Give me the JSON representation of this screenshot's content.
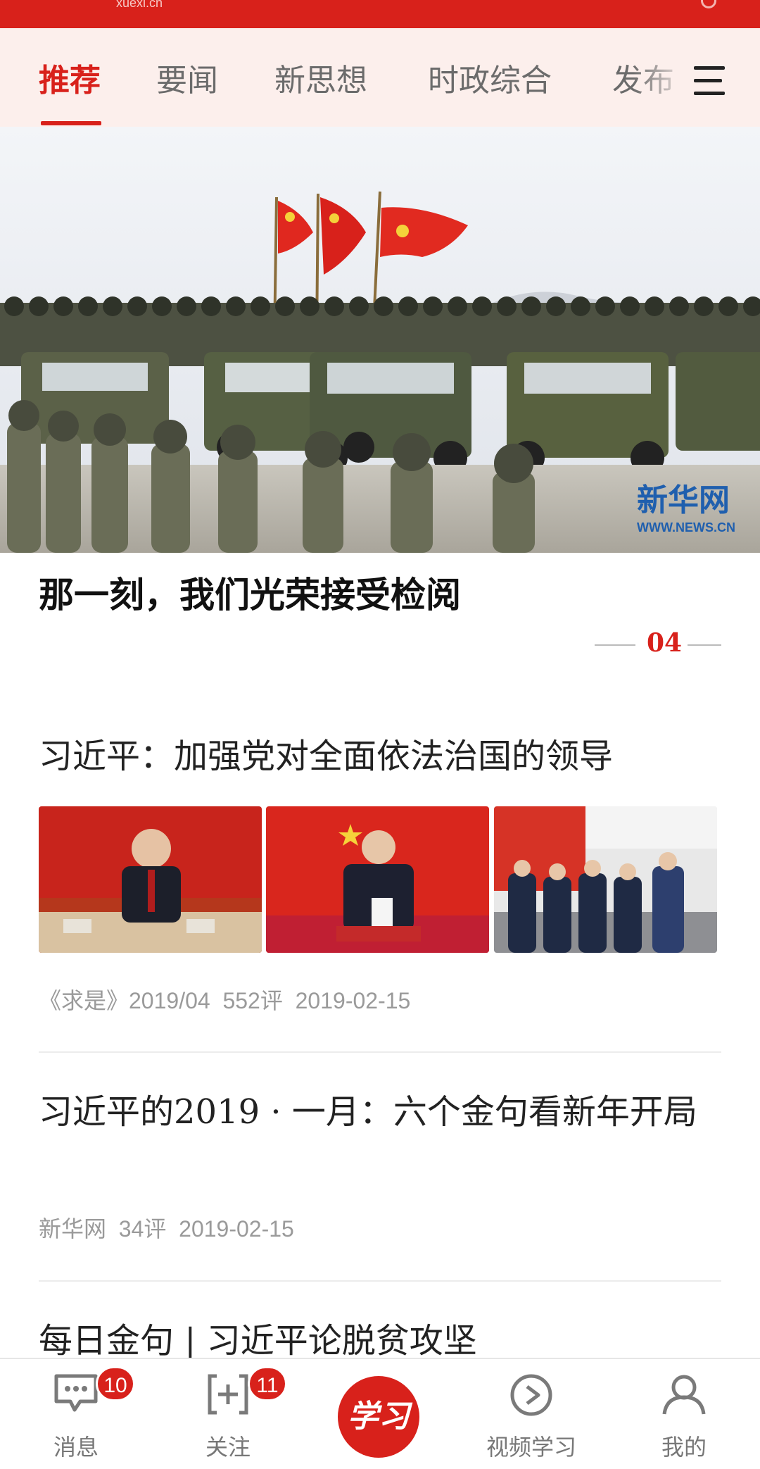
{
  "status_bar": {
    "brand": "xuexi.cn"
  },
  "tabs": [
    {
      "label": "推荐",
      "active": true
    },
    {
      "label": "要闻",
      "active": false
    },
    {
      "label": "新思想",
      "active": false
    },
    {
      "label": "时政综合",
      "active": false
    },
    {
      "label": "发布",
      "active": false
    }
  ],
  "hero": {
    "watermark": "新华网",
    "watermark_url": "WWW.NEWS.CN",
    "caption": "那一刻，我们光荣接受检阅",
    "page_number": "04"
  },
  "feed": [
    {
      "title": "习近平：加强党对全面依法治国的领导",
      "meta": "《求是》2019/04  552评  2019-02-15"
    },
    {
      "title": "习近平的2019 · 一月：六个金句看新年开局",
      "meta": "新华网  34评  2019-02-15"
    },
    {
      "title": "每日金句 | 习近平论脱贫攻坚"
    }
  ],
  "bottom_nav": {
    "messages": {
      "label": "消息",
      "badge": "10"
    },
    "follow": {
      "label": "关注",
      "badge": "11"
    },
    "center": {
      "label": "学习"
    },
    "video": {
      "label": "视频学习"
    },
    "mine": {
      "label": "我的"
    }
  },
  "colors": {
    "accent": "#d8211b",
    "tab_bg": "#fcefec",
    "meta_gray": "#9a9a9a"
  }
}
